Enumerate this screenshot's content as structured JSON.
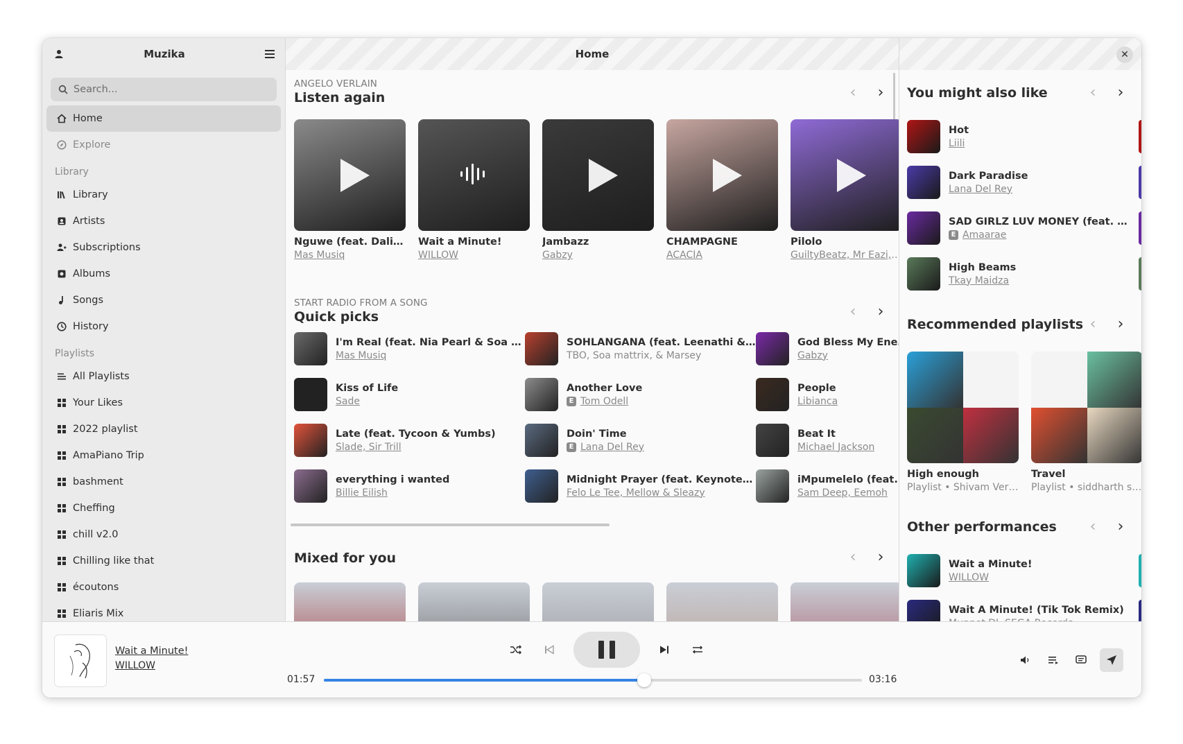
{
  "sidebar": {
    "title": "Muzika",
    "search_placeholder": "Search...",
    "nav": [
      {
        "label": "Home",
        "icon": "home-icon"
      },
      {
        "label": "Explore",
        "icon": "compass-icon"
      }
    ],
    "library_heading": "Library",
    "library": [
      {
        "label": "Library",
        "icon": "library-icon"
      },
      {
        "label": "Artists",
        "icon": "artist-icon"
      },
      {
        "label": "Subscriptions",
        "icon": "subscriptions-icon"
      },
      {
        "label": "Albums",
        "icon": "album-icon"
      },
      {
        "label": "Songs",
        "icon": "music-note-icon"
      },
      {
        "label": "History",
        "icon": "history-icon"
      }
    ],
    "playlists_heading": "Playlists",
    "playlists": [
      {
        "label": "All Playlists",
        "icon": "list-icon"
      },
      {
        "label": "Your Likes",
        "icon": "grid-icon"
      },
      {
        "label": "2022 playlist",
        "icon": "grid-icon"
      },
      {
        "label": "AmaPiano Trip",
        "icon": "grid-icon"
      },
      {
        "label": "bashment",
        "icon": "grid-icon"
      },
      {
        "label": "Cheffing",
        "icon": "grid-icon"
      },
      {
        "label": "chill v2.0",
        "icon": "grid-icon"
      },
      {
        "label": "Chilling like that",
        "icon": "grid-icon"
      },
      {
        "label": "écoutons",
        "icon": "grid-icon"
      },
      {
        "label": "Eliaris Mix",
        "icon": "grid-icon"
      }
    ]
  },
  "main": {
    "title": "Home",
    "listen_again": {
      "subtitle": "ANGELO VERLAIN",
      "title": "Listen again",
      "cards": [
        {
          "title": "Nguwe (feat. Daliwo…",
          "artist": "Mas Musiq",
          "color": "#8a8a8a"
        },
        {
          "title": "Wait a Minute!",
          "artist": "WILLOW",
          "color": "#555555"
        },
        {
          "title": "Jambazz",
          "artist": "Gabzy",
          "color": "#3a3a3a"
        },
        {
          "title": "CHAMPAGNE",
          "artist": "ACACÍA",
          "color": "#c7a6a0"
        },
        {
          "title": "Pilolo",
          "artist": "GuiltyBeatz, Mr Eazi, …",
          "color": "#8f6bd6"
        }
      ]
    },
    "quick_picks": {
      "subtitle": "START RADIO FROM A SONG",
      "title": "Quick picks",
      "items": [
        {
          "title": "I'm Real (feat. Nia Pearl & Soa Mattr…",
          "artist": "Mas Musiq",
          "explicit": false,
          "link": true,
          "color": "#6a6a6a"
        },
        {
          "title": "SOHLANGANA (feat. Leenathi & Ha…",
          "artist": "TBO, Soa mattrix, & Marsey",
          "explicit": false,
          "link": false,
          "color": "#b8402e"
        },
        {
          "title": "God Bless My Enemies",
          "artist": "Gabzy",
          "explicit": false,
          "link": true,
          "color": "#7b2aa8"
        },
        {
          "title": "Kiss of Life",
          "artist": "Sade",
          "explicit": false,
          "link": true,
          "color": "#222222"
        },
        {
          "title": "Another Love",
          "artist": "Tom Odell",
          "explicit": true,
          "link": true,
          "color": "#8c8c8c"
        },
        {
          "title": "People",
          "artist": "Libianca",
          "explicit": false,
          "link": true,
          "color": "#3b2a20"
        },
        {
          "title": "Late (feat. Tycoon & Yumbs)",
          "artist": "Slade, Sir Trill",
          "explicit": false,
          "link": true,
          "color": "#e2533b"
        },
        {
          "title": "Doin' Time",
          "artist": "Lana Del Rey",
          "explicit": true,
          "link": true,
          "color": "#5a6a80"
        },
        {
          "title": "Beat It",
          "artist": "Michael Jackson",
          "explicit": false,
          "link": true,
          "color": "#444444"
        },
        {
          "title": "everything i wanted",
          "artist": "Billie Eilish",
          "explicit": false,
          "link": true,
          "color": "#8b6d8f"
        },
        {
          "title": "Midnight Prayer (feat. Keynote & L…",
          "artist": "Felo Le Tee, Mellow & Sleazy",
          "explicit": false,
          "link": true,
          "color": "#3f5f8f"
        },
        {
          "title": "iMpumelelo (feat. Da M…",
          "artist": "Sam Deep, Eemoh",
          "explicit": false,
          "link": true,
          "color": "#9aa3a0"
        }
      ]
    },
    "mixed_for_you": {
      "title": "Mixed for you",
      "colors": [
        "#a02020",
        "#555555",
        "#888888",
        "#b59080",
        "#a04050"
      ]
    }
  },
  "right": {
    "also_like": {
      "title": "You might also like",
      "items": [
        {
          "title": "Hot",
          "artist": "Liili",
          "explicit": false,
          "color": "#b01515"
        },
        {
          "title": "Dark Paradise",
          "artist": "Lana Del Rey",
          "explicit": false,
          "color": "#4a3aa8"
        },
        {
          "title": "SAD GIRLZ LUV MONEY (feat. Moliy)",
          "artist": "Amaarae",
          "explicit": true,
          "color": "#6a2aa0"
        },
        {
          "title": "High Beams",
          "artist": "Tkay Maidza",
          "explicit": false,
          "color": "#5a7a5a"
        }
      ]
    },
    "playlists": {
      "title": "Recommended playlists",
      "items": [
        {
          "title": "High enough",
          "subtitle": "Playlist • Shivam Ver…",
          "colors": [
            "#2aa0d8",
            "#f4f4f4",
            "#3a4a30",
            "#c03040"
          ]
        },
        {
          "title": "Travel",
          "subtitle": "Playlist • siddharth sin…",
          "colors": [
            "#f4f4f4",
            "#6ac0a0",
            "#e05030",
            "#e8d8c0"
          ]
        }
      ]
    },
    "performances": {
      "title": "Other performances",
      "items": [
        {
          "title": "Wait a Minute!",
          "artist": "WILLOW",
          "color": "#20b0b0"
        },
        {
          "title": "Wait A Minute! (Tik Tok Remix)",
          "artist": "Muppet DJ, SEGA Records",
          "color": "#2a2a80"
        }
      ]
    }
  },
  "player": {
    "title": "Wait a Minute!",
    "artist": "WILLOW",
    "elapsed": "01:57",
    "duration": "03:16",
    "progress": 0.595,
    "accent": "#3584e4"
  }
}
